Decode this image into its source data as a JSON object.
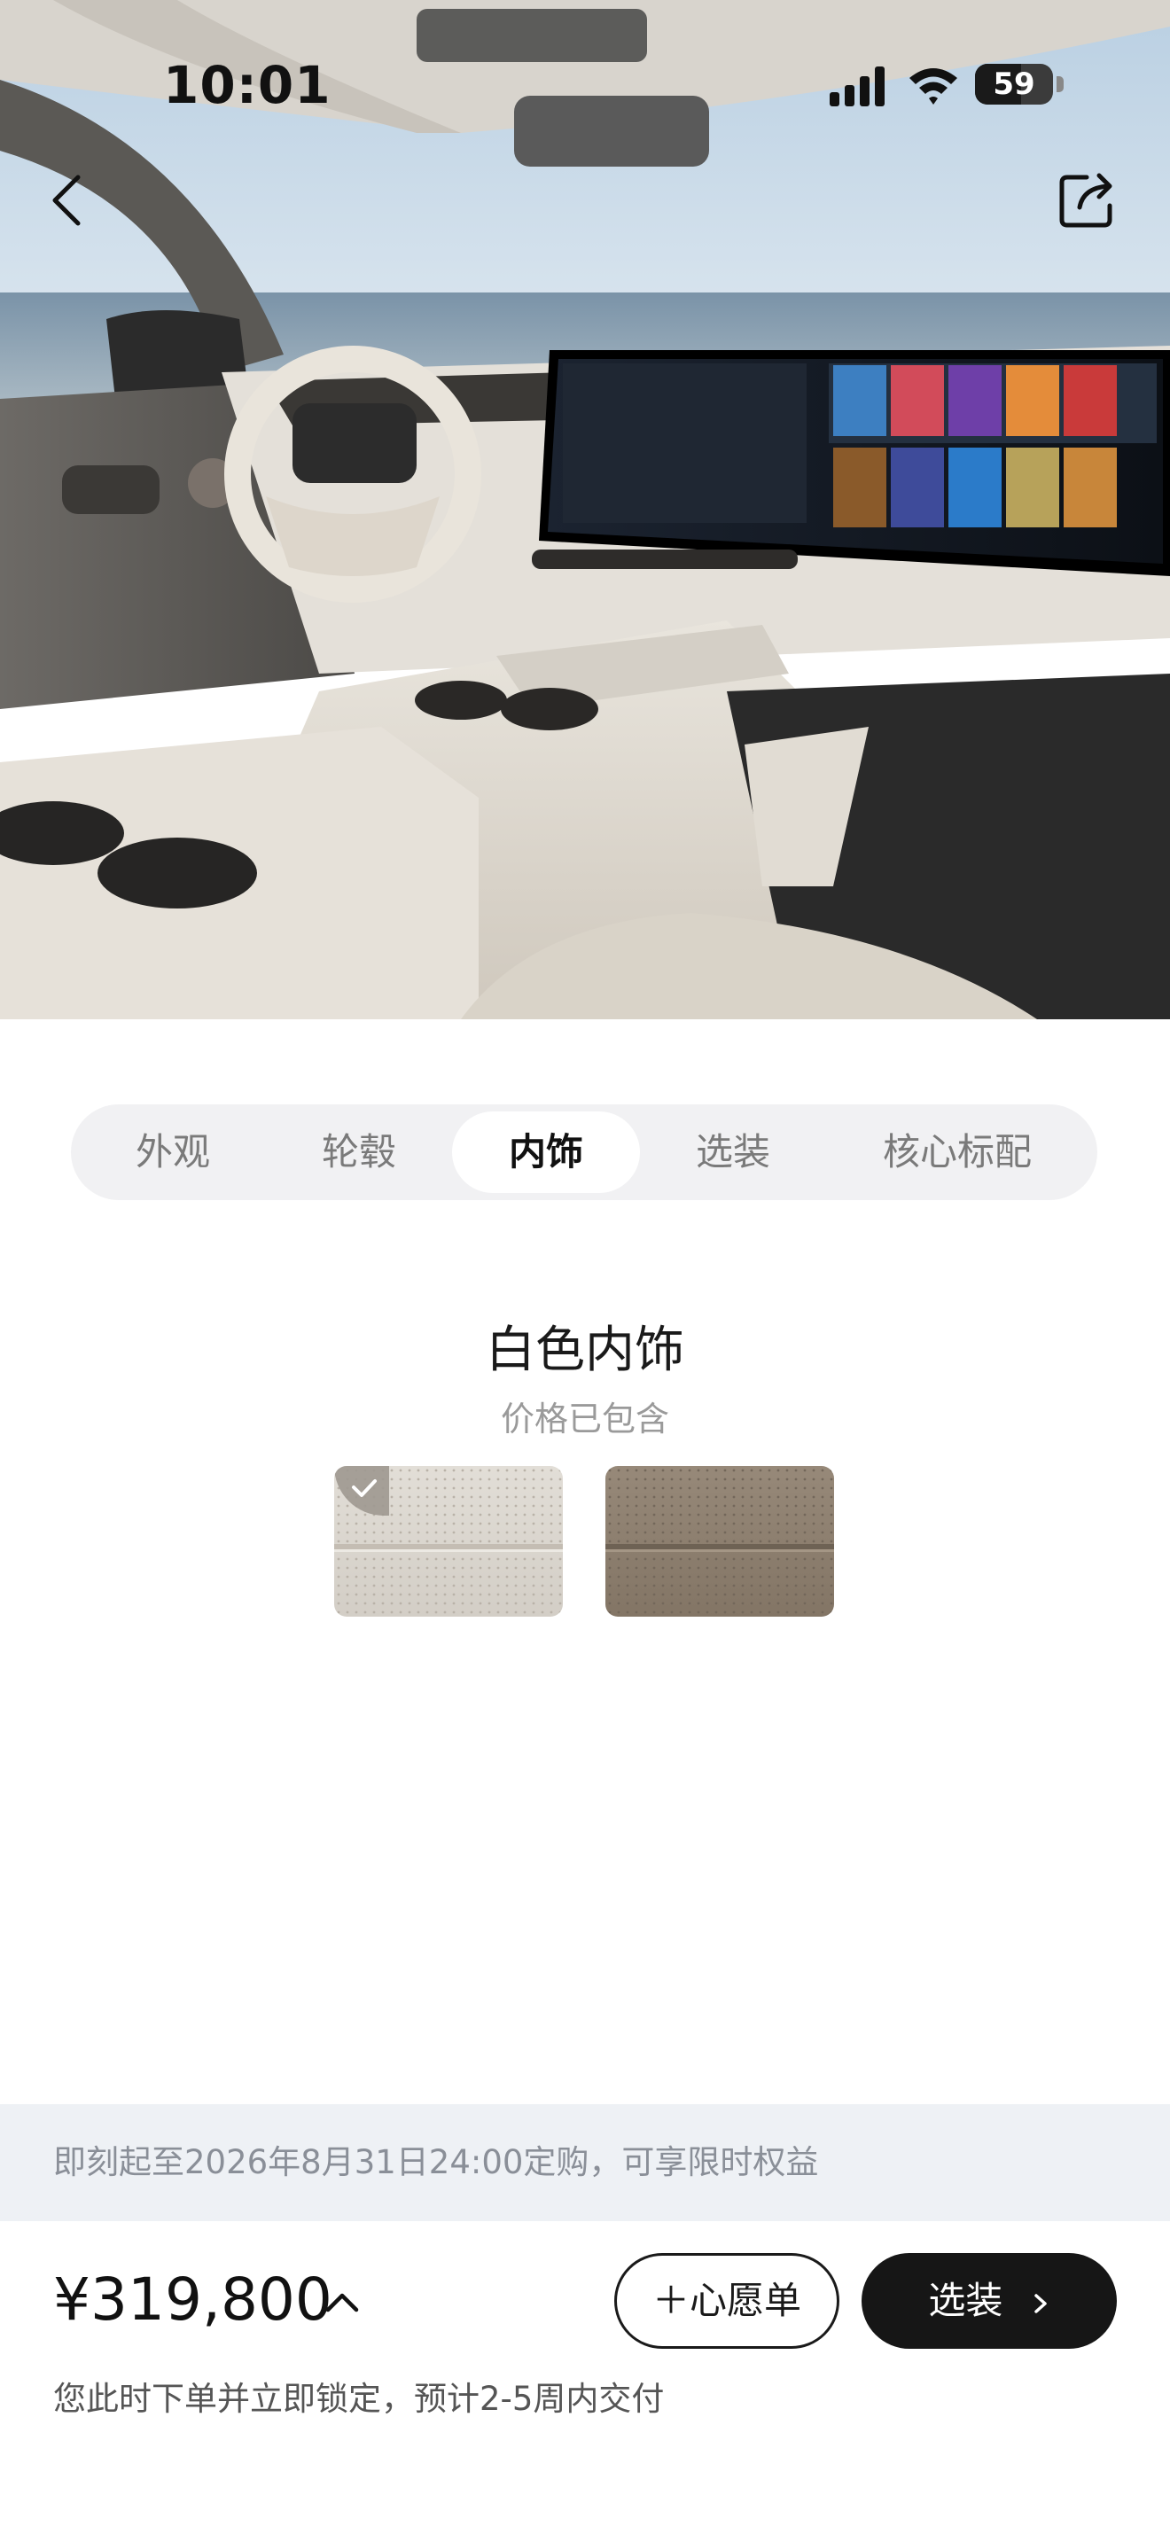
{
  "status_bar": {
    "time": "10:01",
    "battery": "59",
    "battery_level_percent": 59
  },
  "header": {
    "back_icon": "chevron-left-icon",
    "share_icon": "share-icon"
  },
  "tabs": [
    {
      "label": "外观",
      "active": false
    },
    {
      "label": "轮毂",
      "active": false
    },
    {
      "label": "内饰",
      "active": true
    },
    {
      "label": "选装",
      "active": false
    },
    {
      "label": "核心标配",
      "active": false
    }
  ],
  "option": {
    "title": "白色内饰",
    "subtitle": "价格已包含",
    "swatches": [
      {
        "color": "#d8d3cb",
        "selected": true
      },
      {
        "color": "#8d7f70",
        "selected": false
      }
    ]
  },
  "promo": {
    "text": "即刻起至2026年8月31日24:00定购，可享限时权益"
  },
  "footer": {
    "price": "¥319,800",
    "wishlist_label": "＋心愿单",
    "configure_label": "选装",
    "delivery_note": "您此时下单并立即锁定，预计2-5周内交付"
  },
  "colors": {
    "tab_background": "#f1f1f3",
    "promo_background": "#eef1f5",
    "primary_button": "#161616"
  }
}
